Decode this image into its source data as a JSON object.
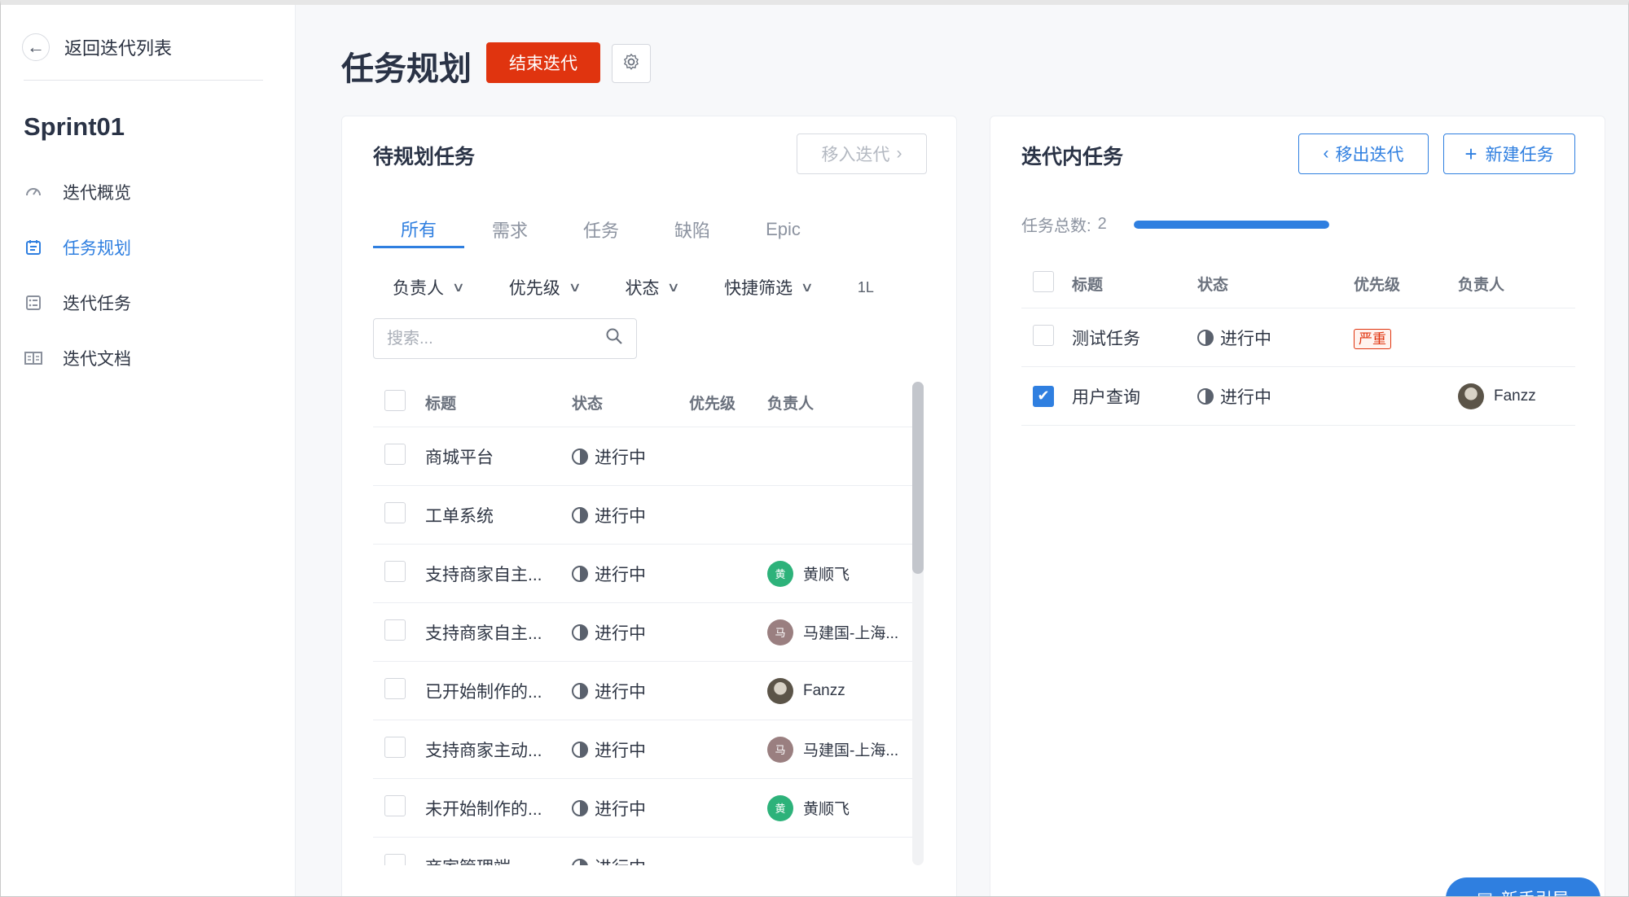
{
  "sidebar": {
    "back_label": "返回迭代列表",
    "sprint_name": "Sprint01",
    "items": [
      {
        "label": "迭代概览",
        "icon": "gauge-icon",
        "active": false
      },
      {
        "label": "任务规划",
        "icon": "calendar-icon",
        "active": true
      },
      {
        "label": "迭代任务",
        "icon": "checklist-icon",
        "active": false
      },
      {
        "label": "迭代文档",
        "icon": "book-icon",
        "active": false
      }
    ]
  },
  "header": {
    "title": "任务规划",
    "end_button": "结束迭代"
  },
  "left_panel": {
    "title": "待规划任务",
    "move_in_button": "移入迭代",
    "tabs": [
      "所有",
      "需求",
      "任务",
      "缺陷",
      "Epic"
    ],
    "filters": [
      "负责人",
      "优先级",
      "状态",
      "快捷筛选"
    ],
    "filter_more": "1L",
    "search_placeholder": "搜索...",
    "columns": {
      "title": "标题",
      "status": "状态",
      "priority": "优先级",
      "owner": "负责人"
    },
    "rows": [
      {
        "title": "商城平台",
        "status": "进行中",
        "priority": "",
        "owner": "",
        "avatar_text": "",
        "avatar_color": ""
      },
      {
        "title": "工单系统",
        "status": "进行中",
        "priority": "",
        "owner": "",
        "avatar_text": "",
        "avatar_color": ""
      },
      {
        "title": "支持商家自主...",
        "status": "进行中",
        "priority": "",
        "owner": "黄顺飞",
        "avatar_text": "黄",
        "avatar_color": "#2db27a"
      },
      {
        "title": "支持商家自主...",
        "status": "进行中",
        "priority": "",
        "owner": "马建国-上海...",
        "avatar_text": "马",
        "avatar_color": "#9a7f80"
      },
      {
        "title": "已开始制作的...",
        "status": "进行中",
        "priority": "",
        "owner": "Fanzz",
        "avatar_text": "",
        "avatar_color": "#6b6458"
      },
      {
        "title": "支持商家主动...",
        "status": "进行中",
        "priority": "",
        "owner": "马建国-上海...",
        "avatar_text": "马",
        "avatar_color": "#9a7f80"
      },
      {
        "title": "未开始制作的...",
        "status": "进行中",
        "priority": "",
        "owner": "黄顺飞",
        "avatar_text": "黄",
        "avatar_color": "#2db27a"
      },
      {
        "title": "商家管理端",
        "status": "进行中",
        "priority": "",
        "owner": "",
        "avatar_text": "",
        "avatar_color": ""
      }
    ]
  },
  "right_panel": {
    "title": "迭代内任务",
    "move_out_button": "移出迭代",
    "new_task_button": "新建任务",
    "count_label": "任务总数:",
    "count_value": "2",
    "progress_fraction": 1.0,
    "columns": {
      "title": "标题",
      "status": "状态",
      "priority": "优先级",
      "owner": "负责人"
    },
    "rows": [
      {
        "title": "测试任务",
        "status": "进行中",
        "priority": "严重",
        "owner": "",
        "checked": false
      },
      {
        "title": "用户查询",
        "status": "进行中",
        "priority": "",
        "owner": "Fanzz",
        "checked": true
      }
    ]
  },
  "guide_button": "新手引导",
  "colors": {
    "accent": "#2f7fe0",
    "danger": "#e0340f"
  }
}
